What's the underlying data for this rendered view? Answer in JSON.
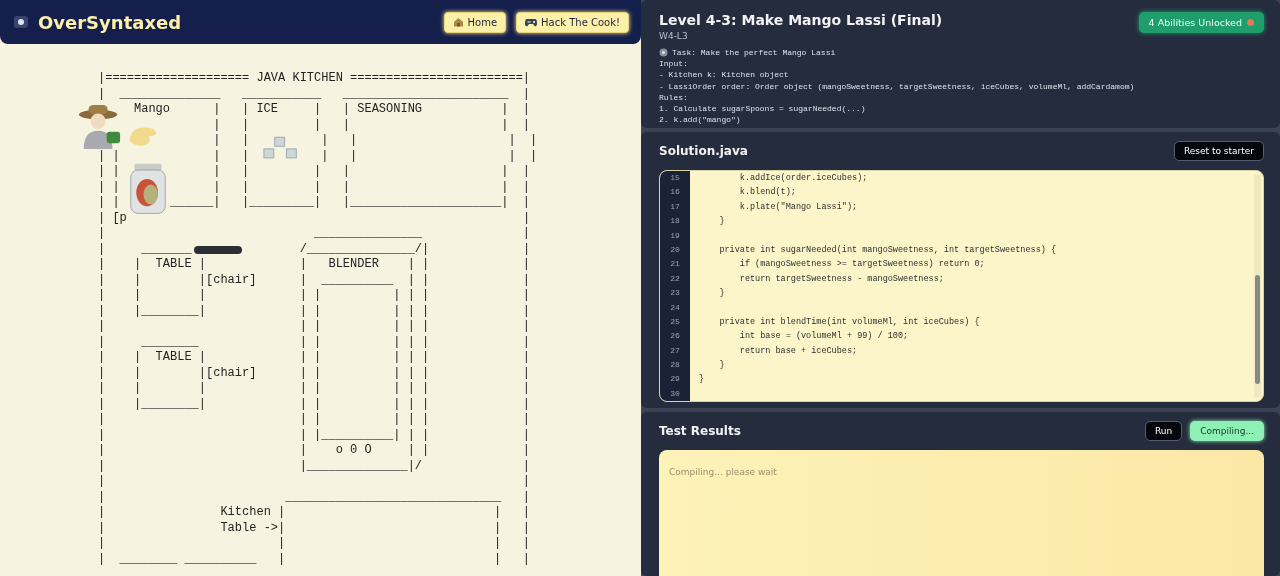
{
  "header": {
    "logo": "OverSyntaxed",
    "nav": [
      {
        "label": "Home"
      },
      {
        "label": "Hack The Cook!"
      }
    ]
  },
  "kitchen": {
    "art_rows": [
      [
        "|==================== JAVA KITCHEN ========================|"
      ],
      [
        "|  ______________   ___________   _______________________  |"
      ],
      [
        "     Mango      |   | ICE     |   | SEASONING           |  |"
      ],
      [
        "                |   |         |   |                     |  |"
      ],
      [
        "                |   |",
        "          |   |                     |  |"
      ],
      [
        "| |",
        "             |   |",
        "          |   |                     |  |"
      ],
      [
        "| |",
        "             |   |         |   |                     |  |"
      ],
      [
        "| |",
        "             |   |         |   |                     |  |"
      ],
      [
        "| |",
        "       ______|   |_________|   |_____________________|  |"
      ],
      [
        "| [p",
        "                                                       |"
      ],
      [
        "|                             _______________              |"
      ],
      [
        "|     _______",
        "               /_______________/|             |"
      ],
      [
        "|    |  TABLE |             |   BLENDER    | |             |"
      ],
      [
        "|    |        |[chair]      |  __________  | |             |"
      ],
      [
        "|    |        |             | |          | | |             |"
      ],
      [
        "|    |________|             | |          | | |             |"
      ],
      [
        "|                           | |          | | |             |"
      ],
      [
        "|     ________              | |          | | |             |"
      ],
      [
        "|    |  TABLE |             | |          | | |             |"
      ],
      [
        "|    |        |[chair]      | |          | | |             |"
      ],
      [
        "|    |        |             | |          | | |             |"
      ],
      [
        "|    |________|             | |          | | |             |"
      ],
      [
        "|                           | |          | | |             |"
      ],
      [
        "|                           | |__________| | |             |"
      ],
      [
        "|                           |    o 0 O     | |             |"
      ],
      [
        "|                           |______________|/              |"
      ],
      [
        "|                                                          |"
      ],
      [
        "|                         ______________________________   |"
      ],
      [
        "|                Kitchen |                             |   |"
      ],
      [
        "|                Table ->|                             |   |"
      ],
      [
        "|                        |                             |   |"
      ],
      [
        "|  ________ __________   |                             |   |"
      ]
    ]
  },
  "level": {
    "title": "Level 4-3: Make Mango Lassi (Final)",
    "code": "W4-L3",
    "badge": "4 Abilities Unlocked",
    "task_heading": "Task: Make the perfect Mango Lassi",
    "task_lines": [
      "Input:",
      "- Kitchen k: Kitchen object",
      "- LassiOrder order: Order object (mangoSweetness, targetSweetness, iceCubes, volumeMl, addCardamom)",
      "Rules:",
      "1. Calculate sugarSpoons = sugarNeeded(...)",
      "2. k.add(\"mango\")"
    ]
  },
  "editor": {
    "filename": "Solution.java",
    "reset_button": "Reset to starter",
    "lines": [
      {
        "number": "15",
        "code": "        k.addIce(order.iceCubes);"
      },
      {
        "number": "16",
        "code": "        k.blend(t);"
      },
      {
        "number": "17",
        "code": "        k.plate(\"Mango Lassi\");"
      },
      {
        "number": "18",
        "code": "    }"
      },
      {
        "number": "19"
      },
      {
        "number": "20",
        "code": "    private int sugarNeeded(int mangoSweetness, int targetSweetness) {"
      },
      {
        "number": "21",
        "code": "        if (mangoSweetness >= targetSweetness) return 0;"
      },
      {
        "number": "22",
        "code": "        return targetSweetness - mangoSweetness;"
      },
      {
        "number": "23",
        "code": "    }"
      },
      {
        "number": "24"
      },
      {
        "number": "25",
        "code": "    private int blendTime(int volumeMl, int iceCubes) {"
      },
      {
        "number": "26",
        "code": "        int base = (volumeMl + 99) / 100;"
      },
      {
        "number": "27",
        "code": "        return base + iceCubes;"
      },
      {
        "number": "28",
        "code": "    }"
      },
      {
        "number": "29",
        "code": "}"
      },
      {
        "number": "30"
      }
    ]
  },
  "tests": {
    "title": "Test Results",
    "run_button": "Run",
    "compile_button": "Compiling...",
    "output": "Compiling... please wait"
  }
}
